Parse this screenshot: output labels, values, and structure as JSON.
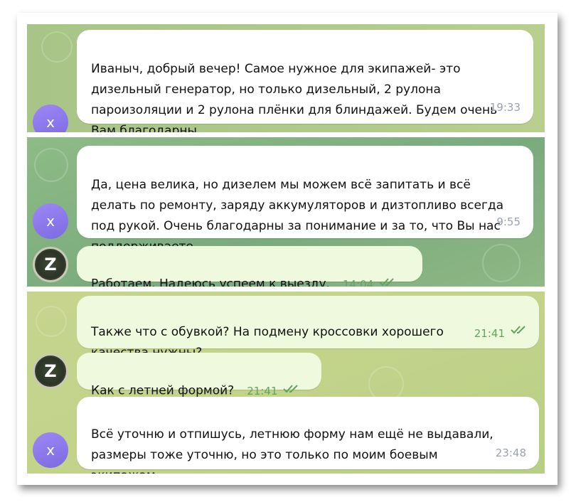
{
  "messages": [
    {
      "text": "Иваныч, добрый вечер! Самое нужное для экипажей- это\nдизельный генератор, но только дизельный, 2 рулона\nпароизоляции и 2 рулона плёнки для блиндажей. Будем очень\nВам благодарны.",
      "time": "19:33",
      "direction": "incoming",
      "avatar": "x"
    },
    {
      "text": "Да, цена велика, но дизелем мы можем всё запитать и всё\nделать по ремонту, заряду аккумуляторов и дизтопливо всегда\nпод рукой. Очень благодарны за понимание и за то, что Вы нас\nподдерживаете.",
      "time": "9:55",
      "direction": "incoming",
      "avatar": "x"
    },
    {
      "text": "Работаем. Надеюсь успеем к выезду.",
      "time": "14:04",
      "direction": "outgoing",
      "avatar": "z",
      "status": "read"
    },
    {
      "text": "Также что с обувкой? На подмену кроссовки хорошего\nкачества нужны?",
      "time": "21:41",
      "direction": "outgoing",
      "status": "read"
    },
    {
      "text": "Как с летней формой?",
      "time": "21:41",
      "direction": "outgoing",
      "avatar": "z",
      "status": "read"
    },
    {
      "text": "Всё уточню и отпишусь, летнюю форму нам ещё не выдавали,\nразмеры тоже уточню, но это только по моим боевым\nэкипажам.",
      "time": "23:48",
      "direction": "incoming",
      "avatar": "x"
    }
  ],
  "avatars": {
    "x": {
      "letter": "x",
      "color": "#8c79ec"
    },
    "z": {
      "letter": "Z",
      "color": "#353e2e"
    }
  },
  "colors": {
    "incoming_bubble": "#ffffff",
    "outgoing_bubble": "#eff9de",
    "read_ticks": "#5fa55f"
  }
}
